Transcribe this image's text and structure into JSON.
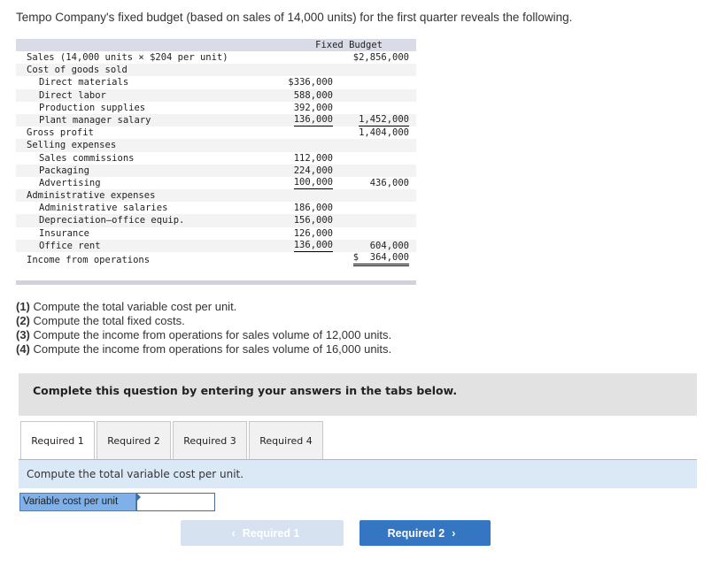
{
  "intro": "Tempo Company's fixed budget (based on sales of 14,000 units) for the first quarter reveals the following.",
  "budget": {
    "header": "Fixed Budget",
    "rows": [
      {
        "label": "Sales (14,000 units × $204 per unit)",
        "c1": "",
        "c2": "$2,856,000"
      },
      {
        "label": "Cost of goods sold",
        "c1": "",
        "c2": ""
      },
      {
        "label": "Direct materials",
        "c1": "$336,000",
        "c2": ""
      },
      {
        "label": "Direct labor",
        "c1": "588,000",
        "c2": ""
      },
      {
        "label": "Production supplies",
        "c1": "392,000",
        "c2": ""
      },
      {
        "label": "Plant manager salary",
        "c1": "136,000",
        "c2": "1,452,000"
      },
      {
        "label": "Gross profit",
        "c1": "",
        "c2": "1,404,000"
      },
      {
        "label": "Selling expenses",
        "c1": "",
        "c2": ""
      },
      {
        "label": "Sales commissions",
        "c1": "112,000",
        "c2": ""
      },
      {
        "label": "Packaging",
        "c1": "224,000",
        "c2": ""
      },
      {
        "label": "Advertising",
        "c1": "100,000",
        "c2": "436,000"
      },
      {
        "label": "Administrative expenses",
        "c1": "",
        "c2": ""
      },
      {
        "label": "Administrative salaries",
        "c1": "186,000",
        "c2": ""
      },
      {
        "label": "Depreciation—office equip.",
        "c1": "156,000",
        "c2": ""
      },
      {
        "label": "Insurance",
        "c1": "126,000",
        "c2": ""
      },
      {
        "label": "Office rent",
        "c1": "136,000",
        "c2": "604,000"
      },
      {
        "label": "Income from operations",
        "c1": "",
        "c2": "$  364,000"
      }
    ]
  },
  "questions": [
    {
      "num": "(1)",
      "text": " Compute the total variable cost per unit."
    },
    {
      "num": "(2)",
      "text": " Compute the total fixed costs."
    },
    {
      "num": "(3)",
      "text": " Compute the income from operations for sales volume of 12,000 units."
    },
    {
      "num": "(4)",
      "text": " Compute the income from operations for sales volume of 16,000 units."
    }
  ],
  "banner": "Complete this question by entering your answers in the tabs below.",
  "tabs": [
    {
      "label": "Required 1",
      "active": true
    },
    {
      "label": "Required 2",
      "active": false
    },
    {
      "label": "Required 3",
      "active": false
    },
    {
      "label": "Required 4",
      "active": false
    }
  ],
  "panel_instruction": "Compute the total variable cost per unit.",
  "field": {
    "label": "Variable cost per unit",
    "value": ""
  },
  "nav": {
    "prev_label": "Required 1",
    "next_label": "Required 2",
    "prev_icon": "chevron-left-icon",
    "next_icon": "chevron-right-icon"
  }
}
